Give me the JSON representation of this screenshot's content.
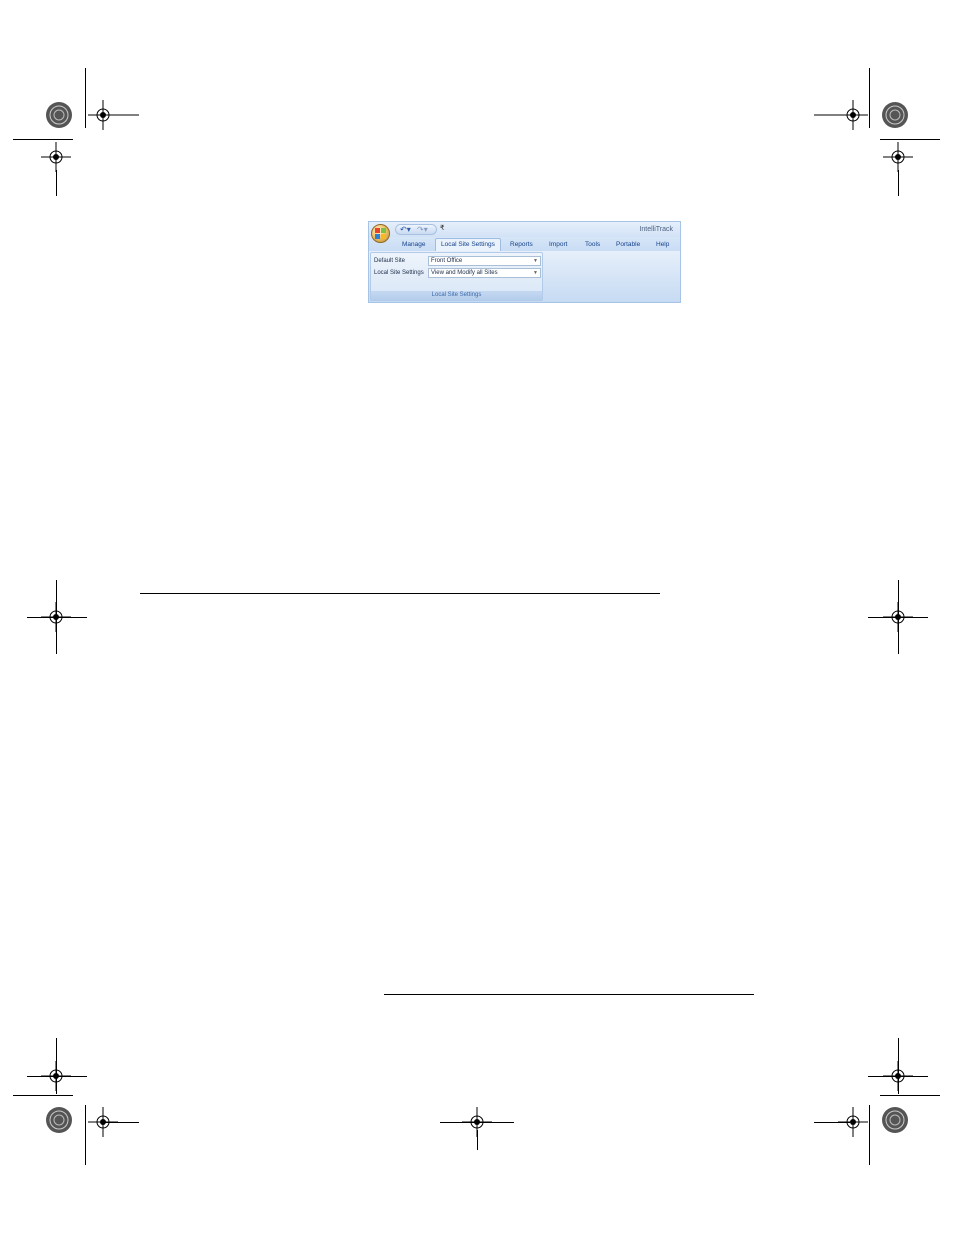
{
  "window": {
    "app_title": "IntelliTrack",
    "quick_access": {
      "undo_icon": "undo-icon",
      "redo_icon": "redo-icon",
      "customize_label": "₹"
    }
  },
  "ribbon": {
    "tabs": [
      {
        "label": "Manage"
      },
      {
        "label": "Local Site Settings",
        "active": true
      },
      {
        "label": "Reports"
      },
      {
        "label": "Import"
      },
      {
        "label": "Tools"
      },
      {
        "label": "Portable"
      },
      {
        "label": "Help"
      }
    ],
    "group": {
      "label": "Local Site Settings",
      "fields": [
        {
          "label": "Default Site",
          "value": "Front Office"
        },
        {
          "label": "Local Site Settings",
          "value": "View and Modify all Sites"
        }
      ]
    }
  },
  "colors": {
    "ribbon_blue": "#c4daf4",
    "tab_text": "#15428b"
  }
}
